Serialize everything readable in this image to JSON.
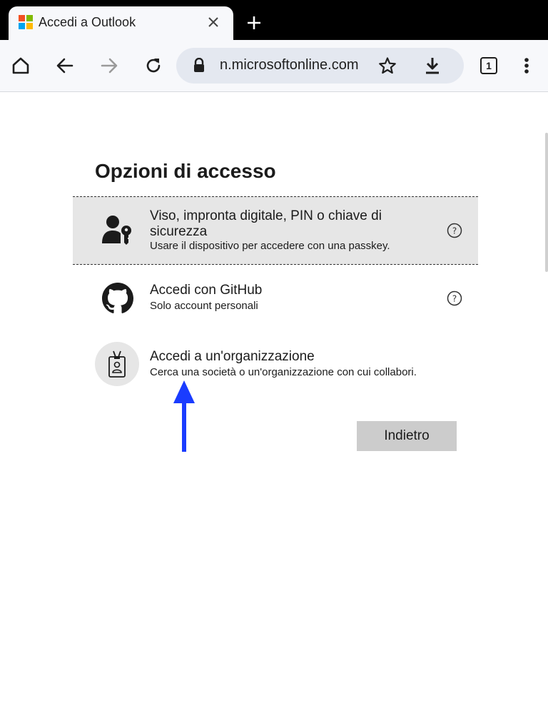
{
  "browser": {
    "tab": {
      "title": "Accedi a Outlook",
      "favicon": "microsoft-logo-icon"
    },
    "toolbar": {
      "url": "n.microsoftonline.com",
      "tab_count": "1"
    }
  },
  "colors": {
    "ms_red": "#f25022",
    "ms_green": "#7fba00",
    "ms_blue": "#00a4ef",
    "ms_yellow": "#ffb900",
    "annotation_arrow": "#1a3cff",
    "selected_option_bg": "#e6e6e6",
    "button_bg": "#cccccc"
  },
  "signin": {
    "heading": "Opzioni di accesso",
    "options": [
      {
        "title": "Viso, impronta digitale, PIN o chiave di sicurezza",
        "description": "Usare il dispositivo per accedere con una passkey.",
        "icon": "user-key-icon",
        "has_help": true,
        "selected": true
      },
      {
        "title": "Accedi con GitHub",
        "description": "Solo account personali",
        "icon": "github-icon",
        "has_help": true
      },
      {
        "title": "Accedi a un'organizzazione",
        "description": "Cerca una società o un'organizzazione con cui collabori.",
        "icon": "badge-icon",
        "has_help": false
      }
    ],
    "back_button": "Indietro"
  }
}
